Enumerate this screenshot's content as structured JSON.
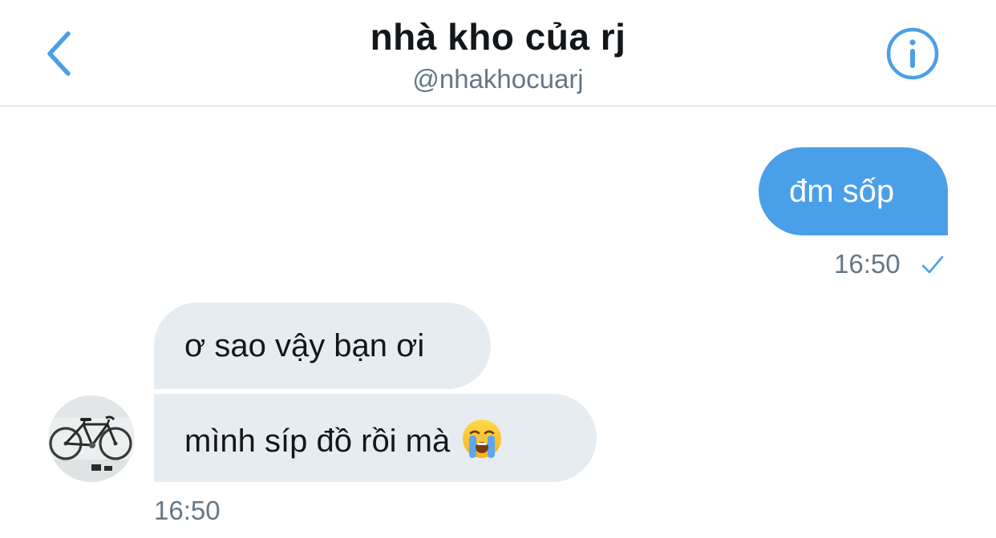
{
  "header": {
    "title": "nhà kho của rj",
    "handle": "@nhakhocuarj",
    "back_icon": "chevron-left-icon",
    "info_icon": "info-circle-icon",
    "accent_color": "#4a9fe9"
  },
  "messages": {
    "outgoing": [
      {
        "text": "đm sốp",
        "time": "16:50",
        "status_icon": "check-icon"
      }
    ],
    "incoming": [
      {
        "text": "ơ sao vậy bạn ơi"
      },
      {
        "text": "mình síp đồ rồi mà",
        "emoji_icon": "loudly-crying-face-icon"
      }
    ],
    "incoming_time": "16:50",
    "avatar_icon": "bicycle-avatar-icon"
  },
  "colors": {
    "outgoing_bubble": "#4a9fe9",
    "incoming_bubble": "#e6ecf0",
    "secondary_text": "#657786",
    "primary_text": "#14171a"
  }
}
